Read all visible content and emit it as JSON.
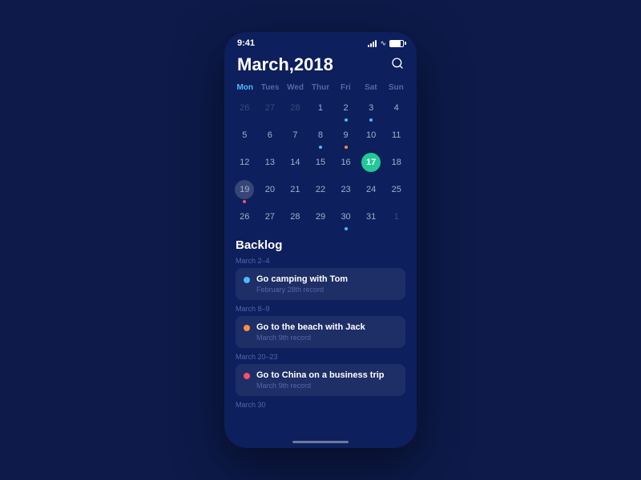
{
  "status": {
    "time": "9:41",
    "battery_label": "battery"
  },
  "header": {
    "title": "March,2018",
    "search_label": "search"
  },
  "calendar": {
    "weekdays": [
      {
        "label": "Mon",
        "class": "monday"
      },
      {
        "label": "Tues",
        "class": "other"
      },
      {
        "label": "Wed",
        "class": "other"
      },
      {
        "label": "Thur",
        "class": "other"
      },
      {
        "label": "Fri",
        "class": "other"
      },
      {
        "label": "Sat",
        "class": "other"
      },
      {
        "label": "Sun",
        "class": "other"
      }
    ],
    "rows": [
      [
        {
          "num": "26",
          "type": "dim",
          "dot": "none"
        },
        {
          "num": "27",
          "type": "dim",
          "dot": "none"
        },
        {
          "num": "28",
          "type": "dim",
          "dot": "none"
        },
        {
          "num": "1",
          "type": "normal",
          "dot": "none"
        },
        {
          "num": "2",
          "type": "normal",
          "dot": "blue"
        },
        {
          "num": "3",
          "type": "normal",
          "dot": "blue"
        },
        {
          "num": "4",
          "type": "normal",
          "dot": "none"
        }
      ],
      [
        {
          "num": "5",
          "type": "normal",
          "dot": "none"
        },
        {
          "num": "6",
          "type": "normal",
          "dot": "none"
        },
        {
          "num": "7",
          "type": "normal",
          "dot": "none"
        },
        {
          "num": "8",
          "type": "normal",
          "dot": "blue"
        },
        {
          "num": "9",
          "type": "normal",
          "dot": "orange"
        },
        {
          "num": "10",
          "type": "normal",
          "dot": "none"
        },
        {
          "num": "11",
          "type": "normal",
          "dot": "none"
        }
      ],
      [
        {
          "num": "12",
          "type": "normal",
          "dot": "none"
        },
        {
          "num": "13",
          "type": "normal",
          "dot": "none"
        },
        {
          "num": "14",
          "type": "normal",
          "dot": "none"
        },
        {
          "num": "15",
          "type": "normal",
          "dot": "none"
        },
        {
          "num": "16",
          "type": "normal",
          "dot": "none"
        },
        {
          "num": "17",
          "type": "today",
          "dot": "none"
        },
        {
          "num": "18",
          "type": "normal",
          "dot": "none"
        }
      ],
      [
        {
          "num": "19",
          "type": "selected",
          "dot": "red"
        },
        {
          "num": "20",
          "type": "normal",
          "dot": "none"
        },
        {
          "num": "21",
          "type": "normal",
          "dot": "none"
        },
        {
          "num": "22",
          "type": "normal",
          "dot": "none"
        },
        {
          "num": "23",
          "type": "normal",
          "dot": "none"
        },
        {
          "num": "24",
          "type": "normal",
          "dot": "none"
        },
        {
          "num": "25",
          "type": "normal",
          "dot": "none"
        }
      ],
      [
        {
          "num": "26",
          "type": "normal",
          "dot": "none"
        },
        {
          "num": "27",
          "type": "normal",
          "dot": "none"
        },
        {
          "num": "28",
          "type": "normal",
          "dot": "none"
        },
        {
          "num": "29",
          "type": "normal",
          "dot": "none"
        },
        {
          "num": "30",
          "type": "normal",
          "dot": "blue"
        },
        {
          "num": "31",
          "type": "normal",
          "dot": "none"
        },
        {
          "num": "1",
          "type": "dim",
          "dot": "none"
        }
      ]
    ]
  },
  "backlog": {
    "title": "Backlog",
    "groups": [
      {
        "date_range": "March 2–4",
        "events": [
          {
            "title": "Go camping with Tom",
            "sub": "February 28th record",
            "dot_color": "#4db8ff"
          }
        ]
      },
      {
        "date_range": "March 8–9",
        "events": [
          {
            "title": "Go to the beach with Jack",
            "sub": "March 9th record",
            "dot_color": "#ff8c42"
          }
        ]
      },
      {
        "date_range": "March 20–23",
        "events": [
          {
            "title": "Go to China on a business trip",
            "sub": "March 9th record",
            "dot_color": "#ff4d6d"
          }
        ]
      },
      {
        "date_range": "March 30",
        "events": []
      }
    ]
  }
}
